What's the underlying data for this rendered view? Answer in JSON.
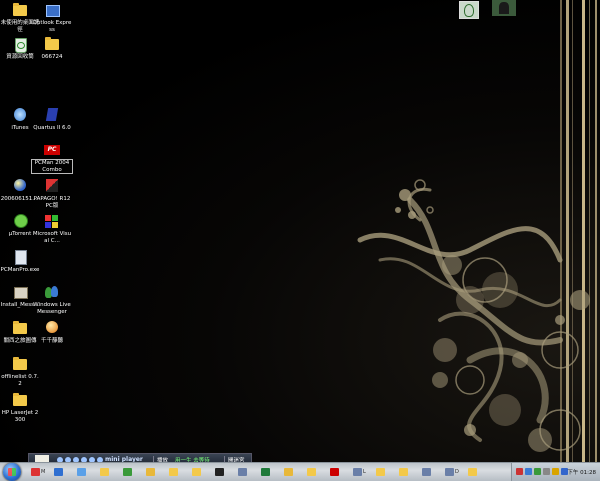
{
  "desktop_icons": [
    {
      "label": "未使用的桌面捷徑",
      "icon": "folder-icon"
    },
    {
      "label": "Outlook Express",
      "icon": "outlook-express-icon"
    },
    {
      "label": "資源回收筒",
      "icon": "recycle-bin-icon"
    },
    {
      "label": "066724",
      "icon": "folder-icon"
    },
    {
      "label": "iTunes",
      "icon": "itunes-icon"
    },
    {
      "label": "Quartus II 6.0",
      "icon": "quartus-icon"
    },
    {
      "label": "PCMan 2004 Combo",
      "icon": "pcman-icon"
    },
    {
      "label": "200606151....",
      "icon": "internet-shortcut-icon"
    },
    {
      "label": "PAPAGO! R12 PC版",
      "icon": "papago-icon"
    },
    {
      "label": "μTorrent",
      "icon": "utorrent-icon"
    },
    {
      "label": "Microsoft Visual C...",
      "icon": "visual-c-icon"
    },
    {
      "label": "PCManPro.exe",
      "icon": "pcmanpro-icon"
    },
    {
      "label": "Install_Mess...",
      "icon": "installer-icon"
    },
    {
      "label": "Windows Live Messenger",
      "icon": "messenger-icon"
    },
    {
      "label": "關西之旅圖傳",
      "icon": "folder-icon"
    },
    {
      "label": "千千靜聽",
      "icon": "ttplayer-icon"
    },
    {
      "label": "offlinelist 0.7.2",
      "icon": "folder-icon"
    },
    {
      "label": "HP LaserJet 2300",
      "icon": "folder-icon"
    }
  ],
  "gadgets": [
    {
      "icon": "tree-gadget-icon"
    },
    {
      "icon": "photo-gadget-icon"
    }
  ],
  "mini_player": {
    "title": "mini player",
    "tab_1": "播放",
    "track": "用一生 去等待",
    "tab_2": "開迷宮"
  },
  "taskbar": {
    "buttons": [
      {
        "label": "M",
        "icon": "gmail-icon"
      },
      {
        "label": "",
        "icon": "ie-icon"
      },
      {
        "label": "",
        "icon": "itunes-icon"
      },
      {
        "label": "",
        "icon": "folder-icon"
      },
      {
        "label": "",
        "icon": "messenger-icon"
      },
      {
        "label": "",
        "icon": "explorer-icon"
      },
      {
        "label": "",
        "icon": "folder-icon"
      },
      {
        "label": "",
        "icon": "folder-icon"
      },
      {
        "label": "",
        "icon": "terminal-icon"
      },
      {
        "label": "",
        "icon": "app-icon"
      },
      {
        "label": "",
        "icon": "excel-icon"
      },
      {
        "label": "",
        "icon": "explorer-icon"
      },
      {
        "label": "",
        "icon": "folder-icon"
      },
      {
        "label": "",
        "icon": "pcman-icon"
      },
      {
        "label": "L",
        "icon": "app-icon"
      },
      {
        "label": "",
        "icon": "folder-icon"
      },
      {
        "label": "",
        "icon": "folder-icon"
      },
      {
        "label": "",
        "icon": "app-icon"
      },
      {
        "label": "D",
        "icon": "app-icon"
      },
      {
        "label": "",
        "icon": "folder-icon"
      }
    ],
    "clock": "下午 01:28"
  },
  "colors": {
    "wallpaper": "#000000",
    "swirl": "#a89c7c",
    "stripe": "#c8b688",
    "taskbar": "#c6ccd2"
  }
}
